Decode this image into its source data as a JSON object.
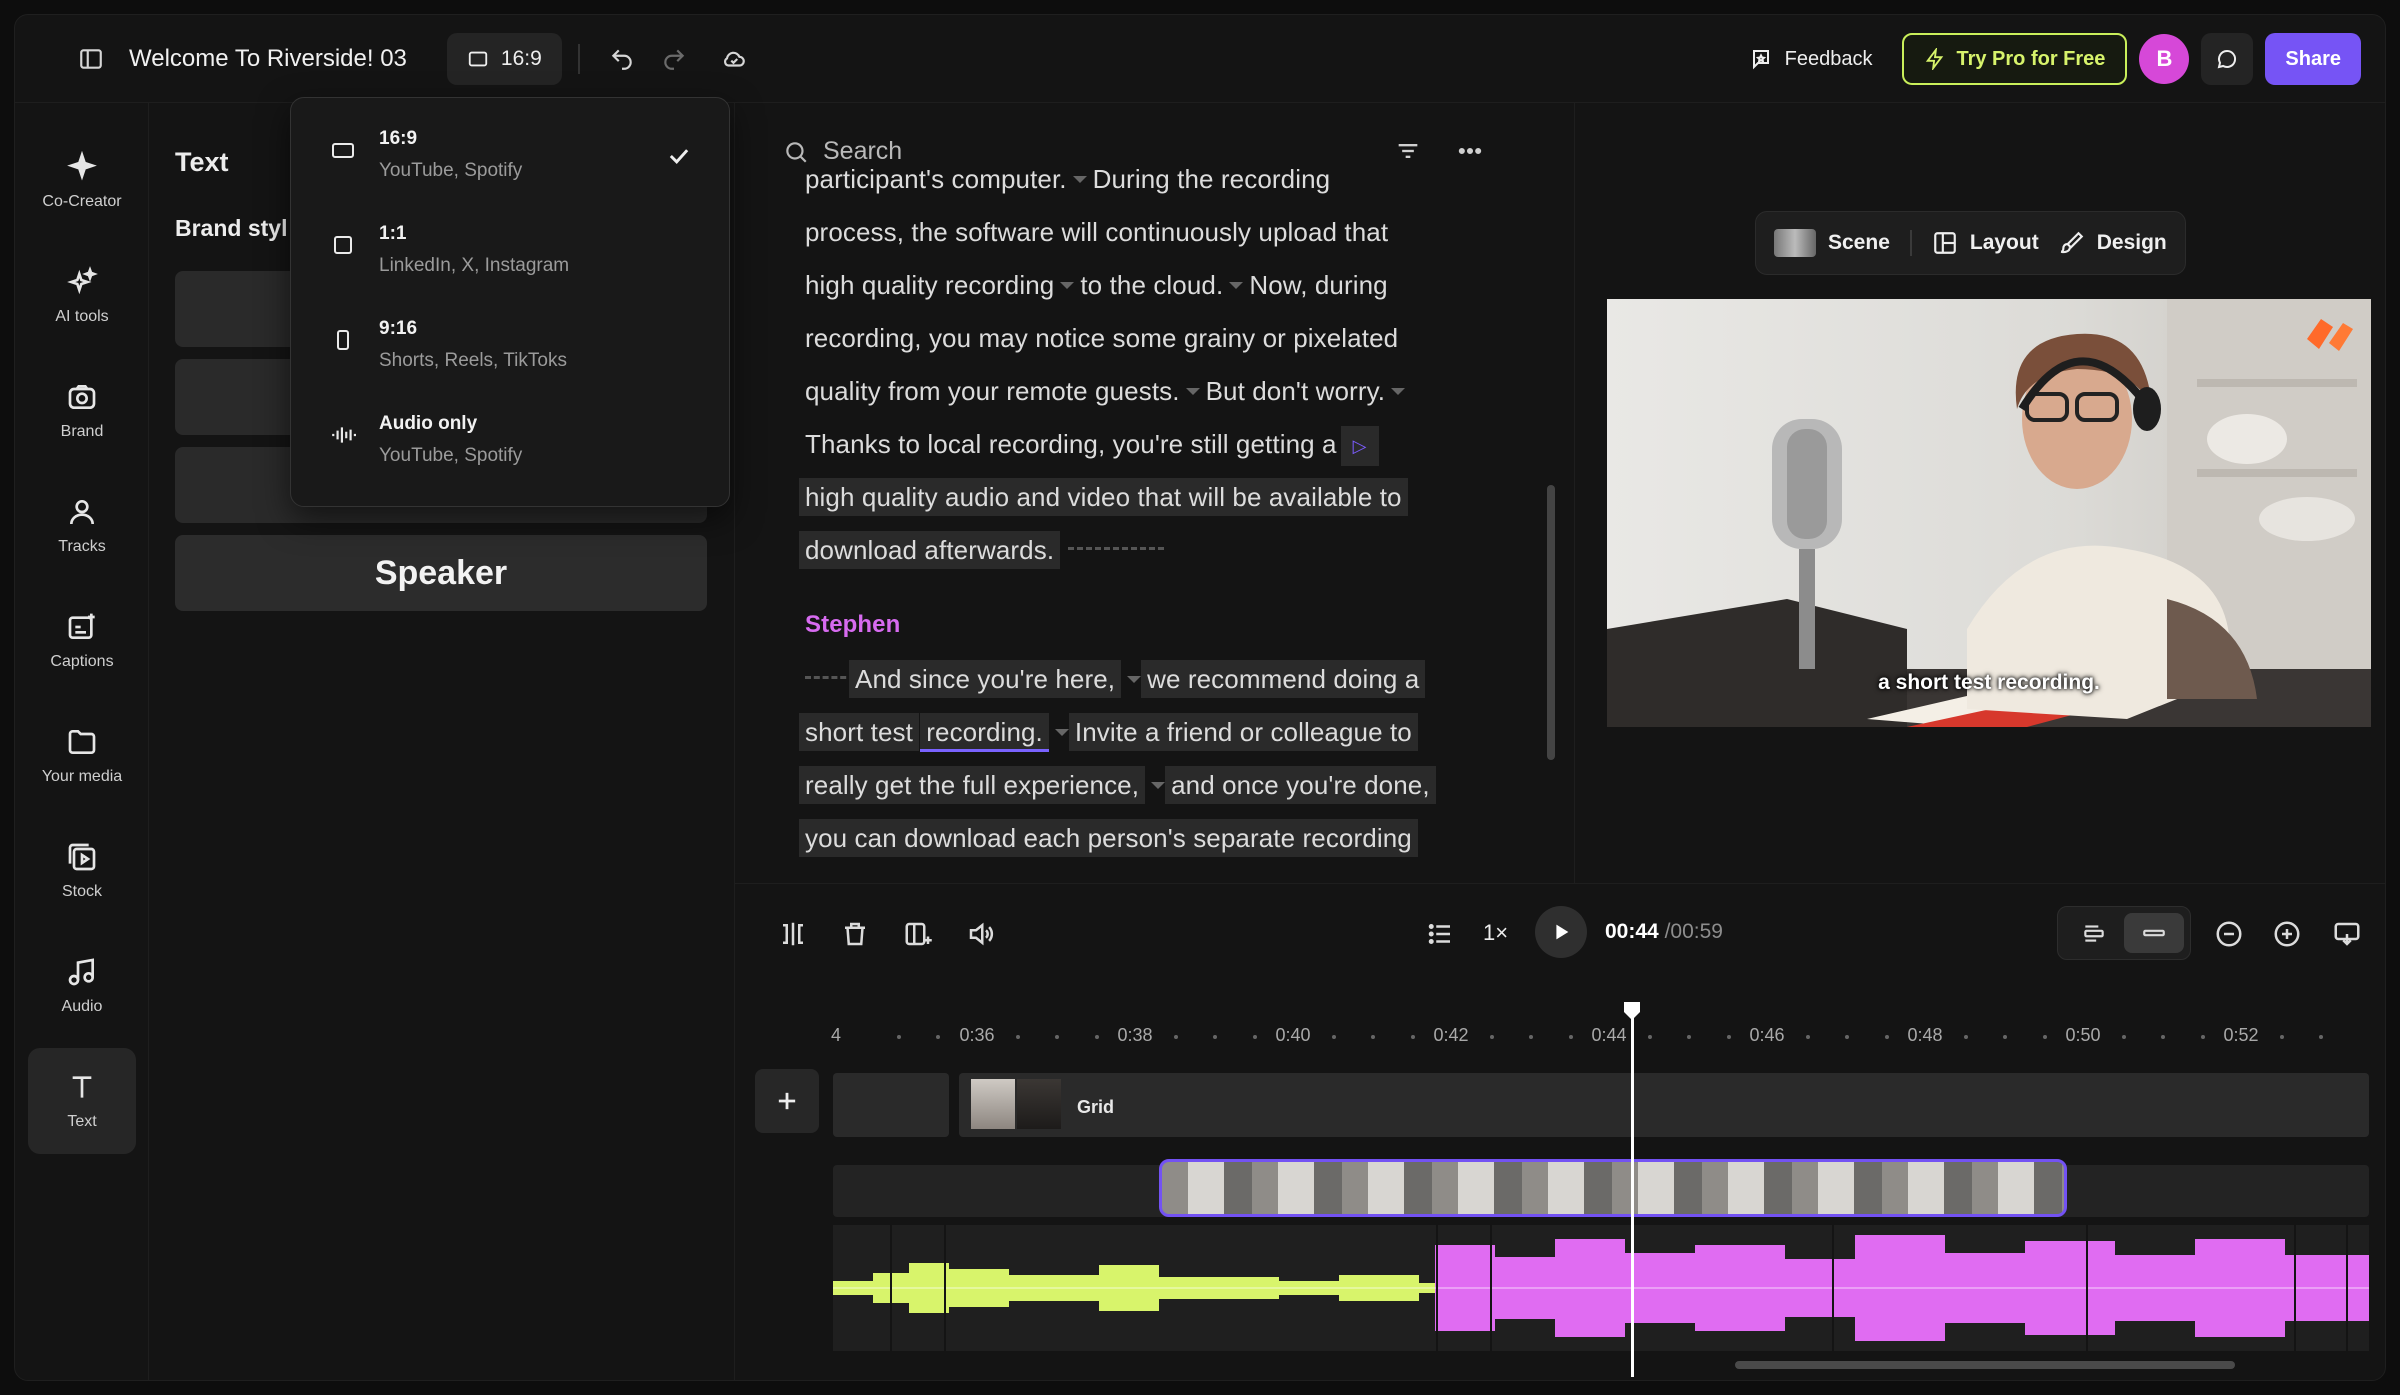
{
  "header": {
    "title": "Welcome To Riverside! 03",
    "ratio": "16:9",
    "feedback": "Feedback",
    "try_pro": "Try Pro for Free",
    "avatar_initial": "B",
    "share": "Share"
  },
  "rail": [
    {
      "label": "Co-Creator",
      "icon": "sparkle-icon"
    },
    {
      "label": "AI tools",
      "icon": "magic-icon"
    },
    {
      "label": "Brand",
      "icon": "brand-icon"
    },
    {
      "label": "Tracks",
      "icon": "people-icon"
    },
    {
      "label": "Captions",
      "icon": "captions-icon"
    },
    {
      "label": "Your media",
      "icon": "folder-icon"
    },
    {
      "label": "Stock",
      "icon": "stock-icon"
    },
    {
      "label": "Audio",
      "icon": "music-icon"
    },
    {
      "label": "Text",
      "icon": "text-icon",
      "active": true
    }
  ],
  "text_panel": {
    "title": "Text",
    "subtitle": "Brand styl",
    "speaker_style": "Speaker"
  },
  "ratio_menu": [
    {
      "label": "16:9",
      "desc": "YouTube, Spotify",
      "selected": true
    },
    {
      "label": "1:1",
      "desc": "LinkedIn, X, Instagram"
    },
    {
      "label": "9:16",
      "desc": "Shorts, Reels, TikToks"
    },
    {
      "label": "Audio only",
      "desc": "YouTube, Spotify"
    }
  ],
  "transcript": {
    "search_placeholder": "Search",
    "lines": [
      "participant's computer.",
      "During the recording",
      "process, the software will continuously upload that",
      "high quality recording",
      "to the cloud.",
      "Now, during",
      "recording, you may notice some grainy or pixelated",
      "quality from your remote guests.",
      "But don't worry.",
      "Thanks to local recording, you're still getting a",
      "high quality audio and video that will be available to",
      "download afterwards."
    ],
    "speaker2": "Stephen",
    "lines2": [
      "And since you're here,",
      "we recommend doing a",
      "short test",
      "recording.",
      "Invite a friend or colleague to",
      "really get the full experience,",
      "and once you're done,",
      "you can download each person's separate recording"
    ]
  },
  "preview": {
    "scene": "Scene",
    "layout": "Layout",
    "design": "Design",
    "caption": "a short test recording."
  },
  "playback": {
    "speed": "1×",
    "current": "00:44",
    "total": "/00:59"
  },
  "timeline": {
    "ticks": [
      "4",
      "0:36",
      "0:38",
      "0:40",
      "0:42",
      "0:44",
      "0:46",
      "0:48",
      "0:50",
      "0:52"
    ],
    "scene_label": "Grid"
  },
  "colors": {
    "accent": "#7654f5",
    "pro": "#d7f36b",
    "speaker": "#d76bf0",
    "wave_a": "#d8f46b",
    "wave_b": "#e06cf2"
  }
}
